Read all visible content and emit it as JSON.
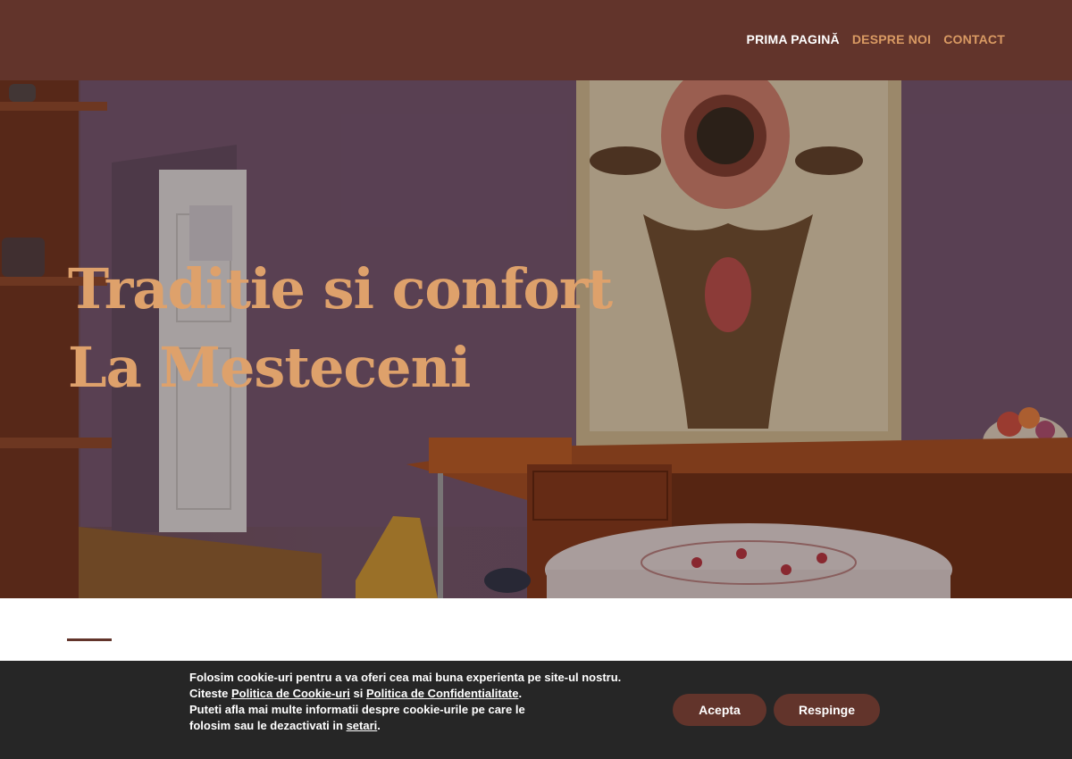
{
  "nav": {
    "items": [
      {
        "label": "PRIMA PAGINĂ",
        "active": true
      },
      {
        "label": "DESPRE NOI",
        "active": false
      },
      {
        "label": "CONTACT",
        "active": false
      }
    ]
  },
  "hero": {
    "title_line1": "Traditie si confort",
    "title_line2": "La Mesteceni"
  },
  "cookie": {
    "line1": "Folosim cookie-uri pentru a va oferi cea mai buna experienta pe site-ul nostru.",
    "line2_prefix": "Citeste ",
    "cookie_policy_link": "Politica de Cookie-uri",
    "line2_mid": " si ",
    "privacy_policy_link": "Politica de Confidentialitate",
    "line2_suffix": ".",
    "line3": "Puteti afla mai multe informatii despre cookie-urile pe care le folosim sau le dezactivati in ",
    "settings_link": "setari",
    "line3_suffix": ".",
    "accept_label": "Acepta",
    "reject_label": "Respinge"
  },
  "colors": {
    "header_bg": "#62342b",
    "nav_accent": "#d99a63",
    "hero_title": "#dea16b",
    "cookie_bg": "#262626",
    "button_bg": "#62342b"
  }
}
